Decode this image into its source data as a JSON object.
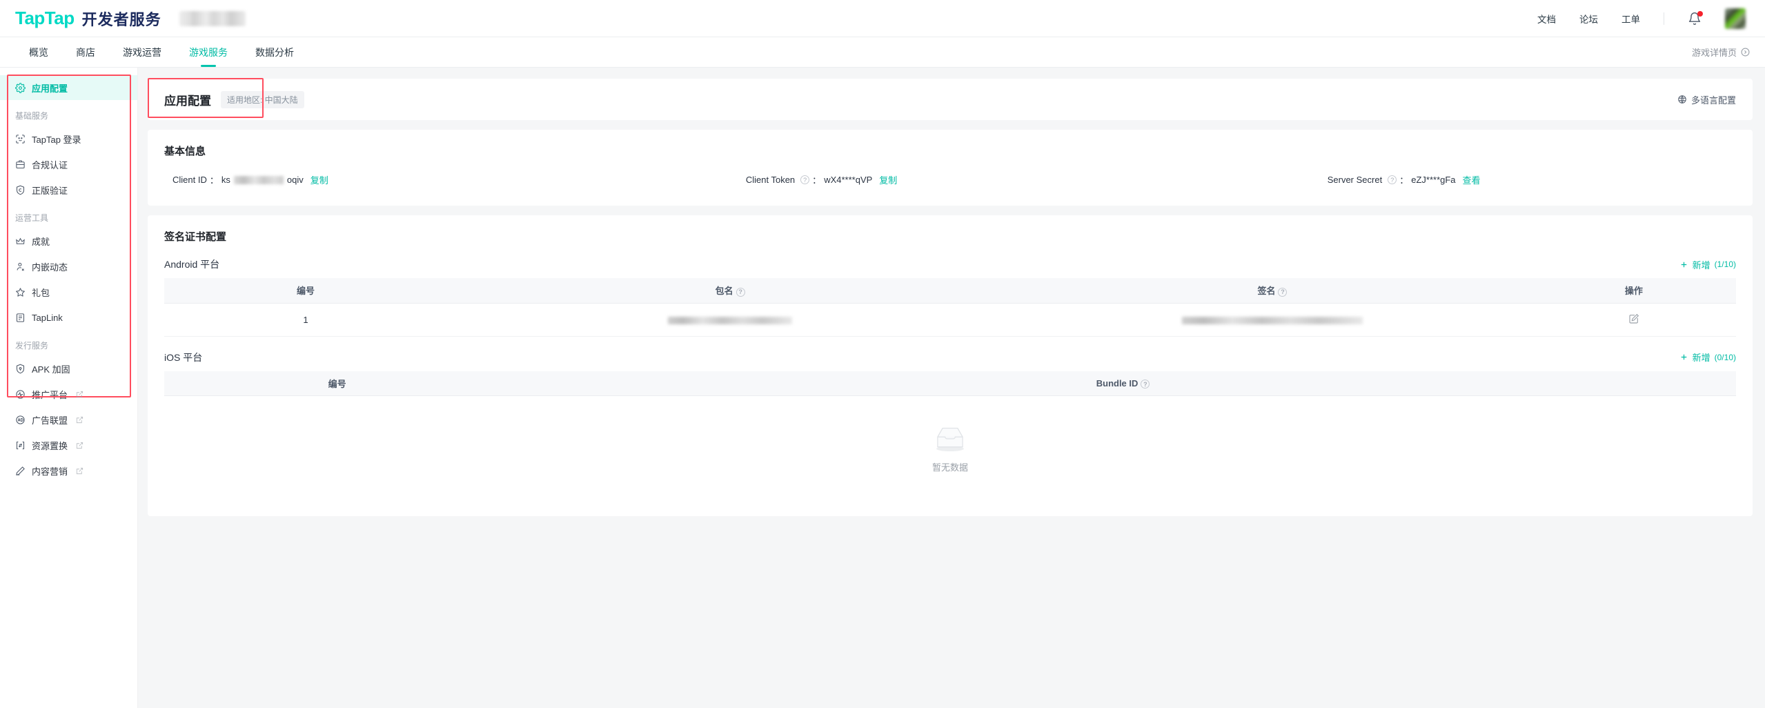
{
  "header": {
    "brand_primary": "TapTap",
    "brand_secondary": "开发者服务",
    "links": [
      {
        "label": "文档",
        "name": "docs"
      },
      {
        "label": "论坛",
        "name": "forum"
      },
      {
        "label": "工单",
        "name": "ticket"
      }
    ],
    "notification_icon": "bell-icon",
    "avatar_icon": "avatar"
  },
  "nav": {
    "tabs": [
      {
        "label": "概览",
        "active": false
      },
      {
        "label": "商店",
        "active": false
      },
      {
        "label": "游戏运营",
        "active": false
      },
      {
        "label": "游戏服务",
        "active": true
      },
      {
        "label": "数据分析",
        "active": false
      }
    ],
    "right_link": "游戏详情页",
    "accent_color": "#00c4ad"
  },
  "sidebar": {
    "items": [
      {
        "label": "应用配置",
        "icon": "gear-icon",
        "active": true,
        "external": false
      },
      {
        "label": "基础服务",
        "type": "group"
      },
      {
        "label": "TapTap 登录",
        "icon": "face-icon",
        "active": false,
        "external": false
      },
      {
        "label": "合规认证",
        "icon": "briefcase-icon",
        "active": false,
        "external": false
      },
      {
        "label": "正版验证",
        "icon": "copyright-shield-icon",
        "active": false,
        "external": false
      },
      {
        "label": "运营工具",
        "type": "group"
      },
      {
        "label": "成就",
        "icon": "crown-icon",
        "active": false,
        "external": false
      },
      {
        "label": "内嵌动态",
        "icon": "person-pin-icon",
        "active": false,
        "external": false
      },
      {
        "label": "礼包",
        "icon": "star-icon",
        "active": false,
        "external": false
      },
      {
        "label": "TapLink",
        "icon": "doc-lines-icon",
        "active": false,
        "external": false
      },
      {
        "label": "发行服务",
        "type": "group"
      },
      {
        "label": "APK 加固",
        "icon": "shield-lock-icon",
        "active": false,
        "external": false
      },
      {
        "label": "推广平台",
        "icon": "pulse-circle-icon",
        "active": false,
        "external": true
      },
      {
        "label": "广告联盟",
        "icon": "ad-circle-icon",
        "active": false,
        "external": true
      },
      {
        "label": "资源置换",
        "icon": "swap-box-icon",
        "active": false,
        "external": true
      },
      {
        "label": "内容营销",
        "icon": "pen-icon",
        "active": false,
        "external": true
      }
    ],
    "highlight_color": "#ff4d5e"
  },
  "page": {
    "title": "应用配置",
    "region_chip": "适用地区: 中国大陆",
    "multilang_label": "多语言配置",
    "multilang_icon": "globe-icon",
    "highlight_color": "#ff4d5e"
  },
  "basic_info": {
    "section_title": "基本信息",
    "fields": [
      {
        "label": "Client ID",
        "has_help": false,
        "colon": "：",
        "value_prefix": "ks",
        "value_suffix": "oqiv",
        "masked": true,
        "action": "复制"
      },
      {
        "label": "Client Token",
        "has_help": true,
        "colon": "：",
        "value": "wX4****qVP",
        "masked": false,
        "action": "复制"
      },
      {
        "label": "Server Secret",
        "has_help": true,
        "colon": "：",
        "value": "eZJ****gFa",
        "masked": false,
        "action": "查看"
      }
    ],
    "link_color": "#00bba4"
  },
  "cert_section": {
    "section_title": "签名证书配置",
    "android": {
      "platform_label": "Android 平台",
      "add_label": "新增",
      "add_count": "(1/10)",
      "columns": [
        "编号",
        "包名",
        "签名",
        "操作"
      ],
      "column_help": [
        false,
        true,
        true,
        false
      ],
      "rows": [
        {
          "index": "1",
          "package": "",
          "signature": "",
          "masked": true,
          "action_icon": "edit-icon"
        }
      ]
    },
    "ios": {
      "platform_label": "iOS 平台",
      "add_label": "新增",
      "add_count": "(0/10)",
      "columns": [
        "编号",
        "Bundle ID"
      ],
      "column_help": [
        false,
        true
      ],
      "empty_text": "暂无数据",
      "empty_icon": "empty-box-icon"
    }
  }
}
